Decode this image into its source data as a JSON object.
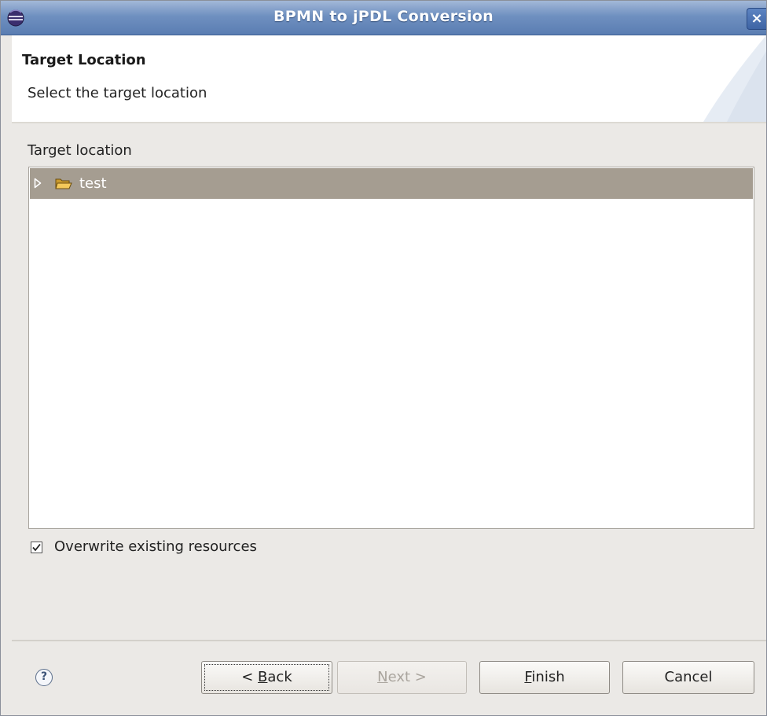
{
  "window": {
    "title": "BPMN to jPDL Conversion",
    "close_glyph": "×"
  },
  "header": {
    "title": "Target Location",
    "description": "Select the target location"
  },
  "target": {
    "label": "Target location",
    "tree": [
      {
        "label": "test",
        "icon": "folder-icon",
        "expanded": false,
        "selected": true
      }
    ]
  },
  "options": {
    "overwrite_label": "Overwrite existing resources",
    "overwrite_checked": true
  },
  "buttons": {
    "help_glyph": "?",
    "back": {
      "prefix": "< ",
      "mnemonic": "B",
      "rest": "ack"
    },
    "next": {
      "mnemonic": "N",
      "rest": "ext >",
      "enabled": false
    },
    "finish": {
      "mnemonic": "F",
      "rest": "inish"
    },
    "cancel": "Cancel"
  },
  "colors": {
    "titlebar": "#6f90c0",
    "selection": "#a59d91",
    "dialog_bg": "#ebe9e6"
  }
}
